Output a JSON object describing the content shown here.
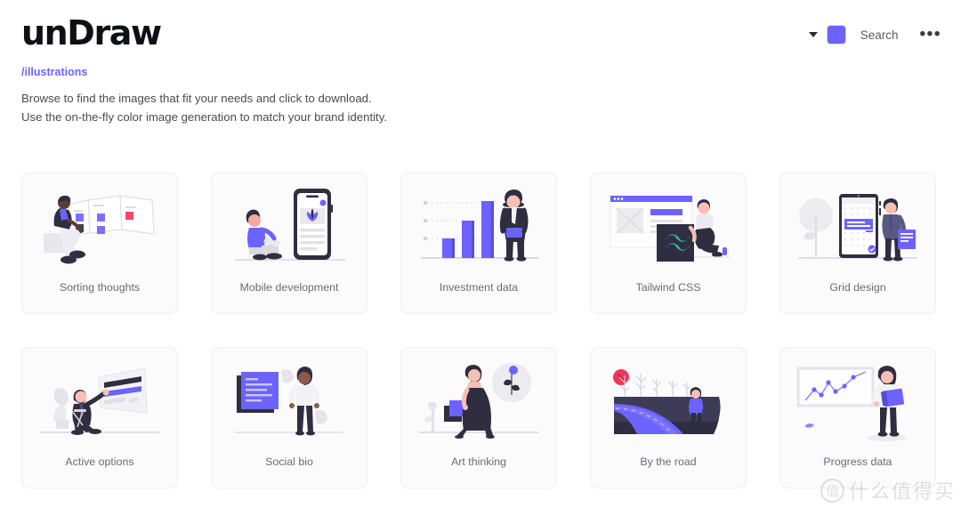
{
  "header": {
    "logo": "unDraw",
    "chevron_icon": "chevron-down-icon",
    "color_swatch_value": "#6c63ff",
    "search_label": "Search",
    "more_menu_label": "•••"
  },
  "breadcrumb": "/illustrations",
  "intro_text": "Browse to find the images that fit your needs and click to download. Use the on-the-fly color image generation to match your brand identity.",
  "theme": {
    "accent": "#6c63ff",
    "dark": "#2f2e41",
    "light_gray": "#e6e6e6",
    "teal": "#38b2ac",
    "red": "#f2365a",
    "text_gray": "#6b6b76"
  },
  "gallery": {
    "items": [
      {
        "id": "sorting-thoughts",
        "label": "Sorting thoughts"
      },
      {
        "id": "mobile-development",
        "label": "Mobile development"
      },
      {
        "id": "investment-data",
        "label": "Investment data"
      },
      {
        "id": "tailwind-css",
        "label": "Tailwind CSS"
      },
      {
        "id": "grid-design",
        "label": "Grid design"
      },
      {
        "id": "active-options",
        "label": "Active options"
      },
      {
        "id": "social-bio",
        "label": "Social bio"
      },
      {
        "id": "art-thinking",
        "label": "Art thinking"
      },
      {
        "id": "by-the-road",
        "label": "By the road"
      },
      {
        "id": "progress-data",
        "label": "Progress data"
      }
    ]
  },
  "watermark": {
    "mark": "值",
    "text": "什么值得买"
  }
}
